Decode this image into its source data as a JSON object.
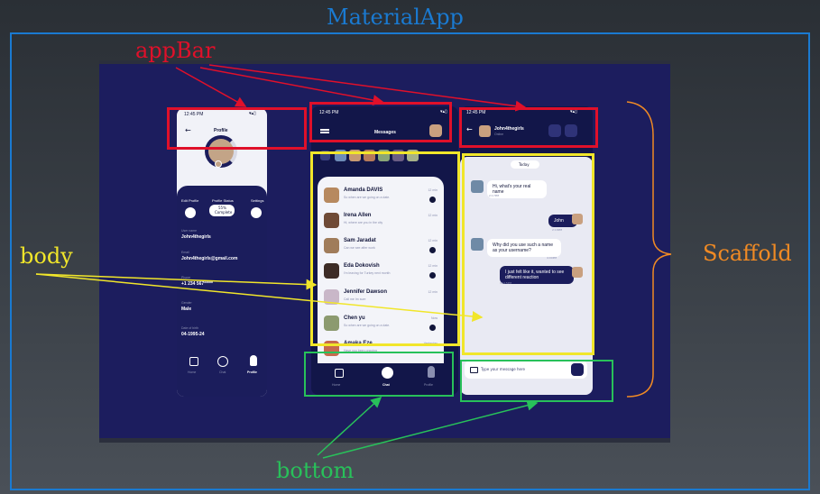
{
  "labels": {
    "material_app": "MaterialApp",
    "app_bar": "appBar",
    "body": "body",
    "bottom": "bottom",
    "scaffold": "Scaffold"
  },
  "colors": {
    "material_app": "#1a7ad1",
    "app_bar": "#e0102a",
    "body": "#f1e62a",
    "bottom": "#28c15a",
    "scaffold": "#f08a24"
  },
  "profile_screen": {
    "time": "12:45 PM",
    "title": "Profile",
    "edit_profile": "Edit Profile",
    "profile_status": "Profile Status",
    "settings": "Settings",
    "status_pct": "55%",
    "status_text": "Complete",
    "fields": [
      {
        "label": "User name",
        "value": "John4thegirls"
      },
      {
        "label": "Email",
        "value": "John4thegirls@gmail.com"
      },
      {
        "label": "Phone",
        "value": "+1 234 567*****"
      },
      {
        "label": "Gender",
        "value": "Male"
      },
      {
        "label": "Date of birth",
        "value": "04-1995-24"
      }
    ],
    "nav": [
      "Home",
      "Chat",
      "Profile"
    ]
  },
  "messages_screen": {
    "time": "12:45 PM",
    "title": "Messages",
    "contacts": [
      {
        "name": "Amanda DAVIS",
        "preview": "So when are we going on a date.",
        "time": "12 min",
        "color": "#b7895f"
      },
      {
        "name": "Irena Allen",
        "preview": "Hi, where are you in the city",
        "time": "12 min",
        "color": "#6f4a36"
      },
      {
        "name": "Sam Jaradat",
        "preview": "Can we see after work",
        "time": "12 min",
        "color": "#a07c5a"
      },
      {
        "name": "Eda Dokovish",
        "preview": "I'm leaving for Turkey next month",
        "time": "12 min",
        "color": "#3d2c26"
      },
      {
        "name": "Jennifer Dawson",
        "preview": "Call me Im sure",
        "time": "12 min",
        "color": "#c9b7c8"
      },
      {
        "name": "Chen yu",
        "preview": "So when are we going on a date.",
        "time": "Now",
        "color": "#8c9a6f"
      },
      {
        "name": "Amaka Eze",
        "preview": "Have you been ongoing",
        "time": "Yesterday",
        "color": "#c66a4e"
      }
    ],
    "nav": [
      "Home",
      "Chat",
      "Profile"
    ]
  },
  "chat_screen": {
    "time": "12:45 PM",
    "user": "John4thegirls",
    "status": "Online",
    "day": "Today",
    "messages": [
      {
        "side": "in",
        "text": "Hi, what's your real name",
        "time": "2:17PM"
      },
      {
        "side": "out",
        "text": "John",
        "time": "2:18PM"
      },
      {
        "side": "in",
        "text": "Why did you use such a name as your username?",
        "time": "4:00PM"
      },
      {
        "side": "out",
        "text": "I just felt like it, wanted to see different reaction",
        "time": "10:15PM"
      }
    ],
    "input_placeholder": "Type your message here"
  }
}
